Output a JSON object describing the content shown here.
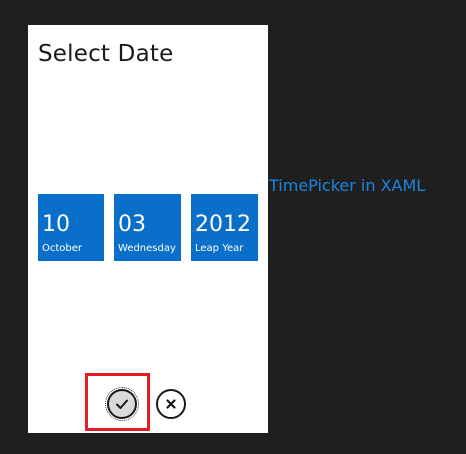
{
  "dialog": {
    "title": "Select Date"
  },
  "tiles": {
    "day": {
      "value": "10",
      "caption": "October"
    },
    "month": {
      "value": "03",
      "caption": "Wednesday"
    },
    "year": {
      "value": "2012",
      "caption": "Leap Year"
    }
  },
  "side_label": "TimePicker in XAML",
  "buttons": {
    "accept_icon": "checkmark-icon",
    "cancel_icon": "close-icon"
  },
  "colors": {
    "tile": "#0a6fc9",
    "accent_text": "#1a84e0",
    "highlight": "#e31e24",
    "background": "#1f1f1f"
  }
}
